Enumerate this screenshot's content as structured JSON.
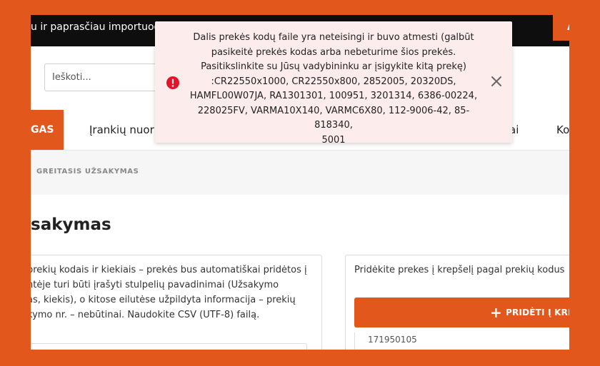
{
  "topbar": {
    "promo": "u ir paprasčiau importuodami",
    "button_label": "A"
  },
  "search": {
    "placeholder": "Ieškoti..."
  },
  "nav": {
    "items": [
      "GAS",
      "Įrankių nuor",
      "ai",
      "Ko"
    ]
  },
  "breadcrumb": {
    "current": "GREITASIS UŽSAKYMAS"
  },
  "page": {
    "title": "sakymas"
  },
  "left_panel": {
    "lines": [
      "prekių kodais ir kiekiais – prekės bus automatiškai pridėtos į",
      "ntėje turi būti įrašyti stulpelių pavadinimai (Užsakymo",
      "as, kiekis), o kitose eilutėse užpildyta informacija – prekių",
      "kymo nr. – nebūtinai. Naudokite CSV (UTF-8) failą."
    ]
  },
  "right_panel": {
    "description": "Pridėkite prekes į krepšelį pagal prekių kodus",
    "add_button": {
      "plus": "+",
      "label": "PRIDĖTI Į KRE"
    },
    "partial_code": "171950105"
  },
  "alert": {
    "lines": [
      "Dalis prekės kodų faile yra neteisingi ir buvo atmesti (galbūt",
      "pasikeitė prekės kodas arba nebeturime šios prekės.",
      "Pasitikslinkite su Jūsų vadybininku ar įsigykite kitą prekę)",
      ":CR22550x1000, CR22550x800, 2852005, 20320DS,",
      "HAMFL00W07JA, RA1301301, 100951, 3201314, 6386-00224,",
      "228025FV, VARMA10X140, VARMC6X80, 112-9006-42, 85-818340,",
      "5001"
    ]
  },
  "colors": {
    "brand_orange": "#e2571b",
    "topbar_black": "#0e0e0e",
    "alert_bg": "#fdecec",
    "alert_icon_red": "#e0142a"
  },
  "icons": {
    "alert": "info-circle-icon",
    "close": "close-icon"
  }
}
